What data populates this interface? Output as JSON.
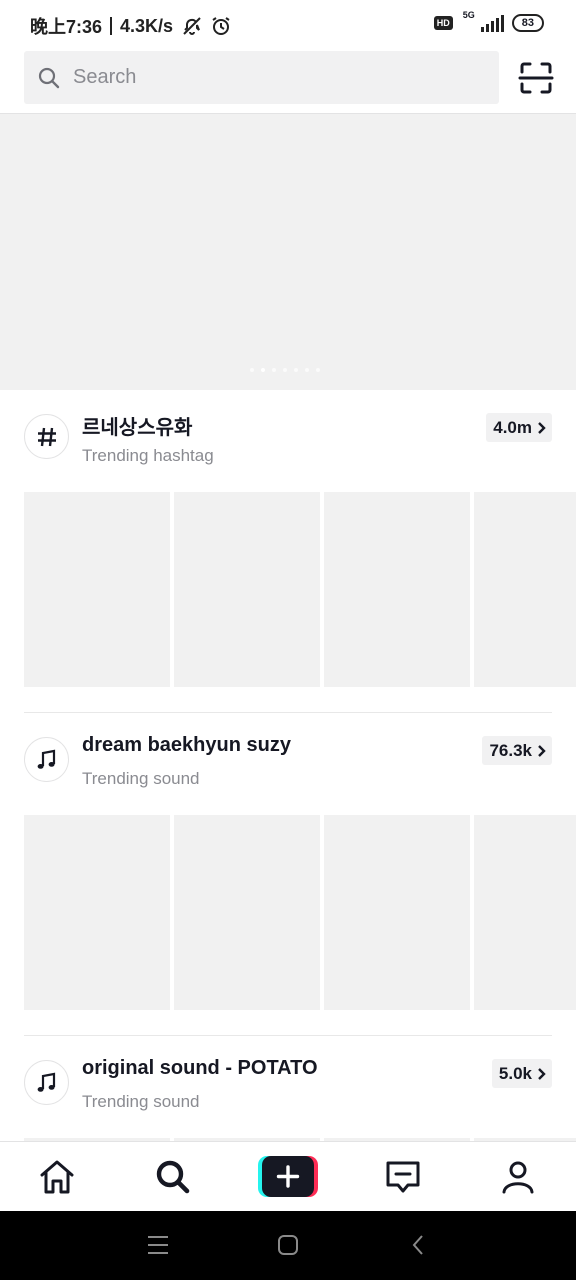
{
  "status_bar": {
    "time": "晚上7:36",
    "speed": "4.3K/s",
    "hd": "HD",
    "network": "5G",
    "battery": "83"
  },
  "search": {
    "placeholder": "Search"
  },
  "banner": {
    "dot_count": 7,
    "active_index": 1
  },
  "sections": [
    {
      "icon": "hashtag-icon",
      "title": "르네상스유화",
      "subtitle": "Trending hashtag",
      "count": "4.0m"
    },
    {
      "icon": "music-note-icon",
      "title": "dream baekhyun suzy",
      "subtitle": "Trending sound",
      "count": "76.3k"
    },
    {
      "icon": "music-note-icon",
      "title": "original sound - POTATO",
      "subtitle": "Trending sound",
      "count": "5.0k"
    }
  ],
  "bottom_nav": [
    "home-icon",
    "search-icon",
    "create-icon",
    "inbox-icon",
    "profile-icon"
  ],
  "colors": {
    "text": "#161823",
    "secondary_text": "#8a8b91",
    "placeholder_bg": "#f1f1f1",
    "accent_cyan": "#25f4ee",
    "accent_red": "#fe2c55"
  }
}
